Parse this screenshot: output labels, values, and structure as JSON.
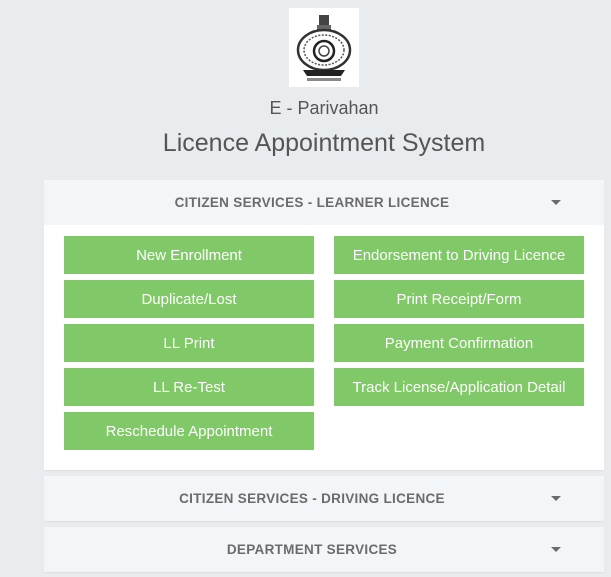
{
  "header": {
    "logo": "state-emblem",
    "subtitle": "E - Parivahan",
    "title": "Licence Appointment System"
  },
  "panels": [
    {
      "title": "CITIZEN SERVICES - LEARNER LICENCE",
      "expanded": true,
      "buttons": [
        "New Enrollment",
        "Endorsement to Driving Licence",
        "Duplicate/Lost",
        "Print Receipt/Form",
        "LL Print",
        "Payment Confirmation",
        "LL Re-Test",
        "Track License/Application Detail",
        "Reschedule Appointment"
      ]
    },
    {
      "title": "CITIZEN SERVICES - DRIVING LICENCE",
      "expanded": false
    },
    {
      "title": "DEPARTMENT SERVICES",
      "expanded": false
    }
  ],
  "colors": {
    "button_bg": "#80c868",
    "panel_header_bg": "#f2f6f9",
    "page_bg": "#e9ecef"
  }
}
